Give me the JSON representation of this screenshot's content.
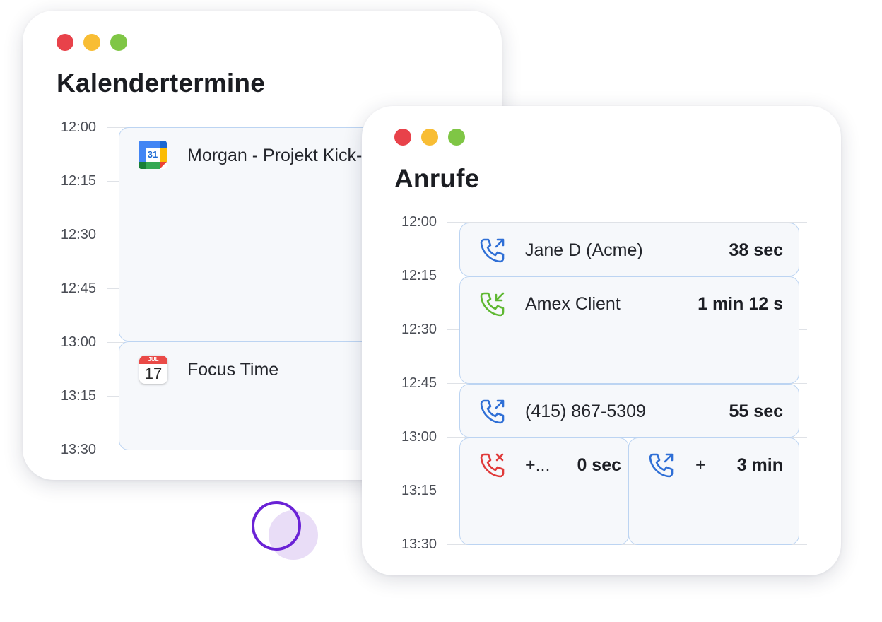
{
  "calendar_window": {
    "title": "Kalendertermine",
    "time_labels": [
      "12:00",
      "12:15",
      "12:30",
      "12:45",
      "13:00",
      "13:15",
      "13:30"
    ],
    "events": [
      {
        "title": "Morgan - Projekt Kick-off",
        "icon": "google-calendar-icon",
        "icon_text": "31"
      },
      {
        "title": "Focus Time",
        "icon": "apple-calendar-icon",
        "icon_month": "JUL",
        "icon_day": "17"
      }
    ]
  },
  "calls_window": {
    "title": "Anrufe",
    "time_labels": [
      "12:00",
      "12:15",
      "12:30",
      "12:45",
      "13:00",
      "13:15",
      "13:30"
    ],
    "calls": [
      {
        "name": "Jane D (Acme)",
        "duration": "38 sec",
        "type": "outgoing",
        "icon": "outgoing-call-icon"
      },
      {
        "name": "Amex Client",
        "duration": "1 min 12 s",
        "type": "incoming",
        "icon": "incoming-call-icon"
      },
      {
        "name": "(415) 867-5309",
        "duration": "55 sec",
        "type": "outgoing",
        "icon": "outgoing-call-icon"
      },
      {
        "name": "+...",
        "duration": "0 sec",
        "type": "missed",
        "icon": "missed-call-icon"
      },
      {
        "name": "+",
        "duration": "3 min",
        "type": "outgoing",
        "icon": "outgoing-call-icon"
      }
    ]
  },
  "colors": {
    "outgoing": "#2f6fd6",
    "incoming": "#5fb832",
    "missed": "#e03a3a",
    "event_border": "#bcd4f2",
    "event_bg": "#f6f8fb",
    "accent_ring": "#6a22d6"
  }
}
